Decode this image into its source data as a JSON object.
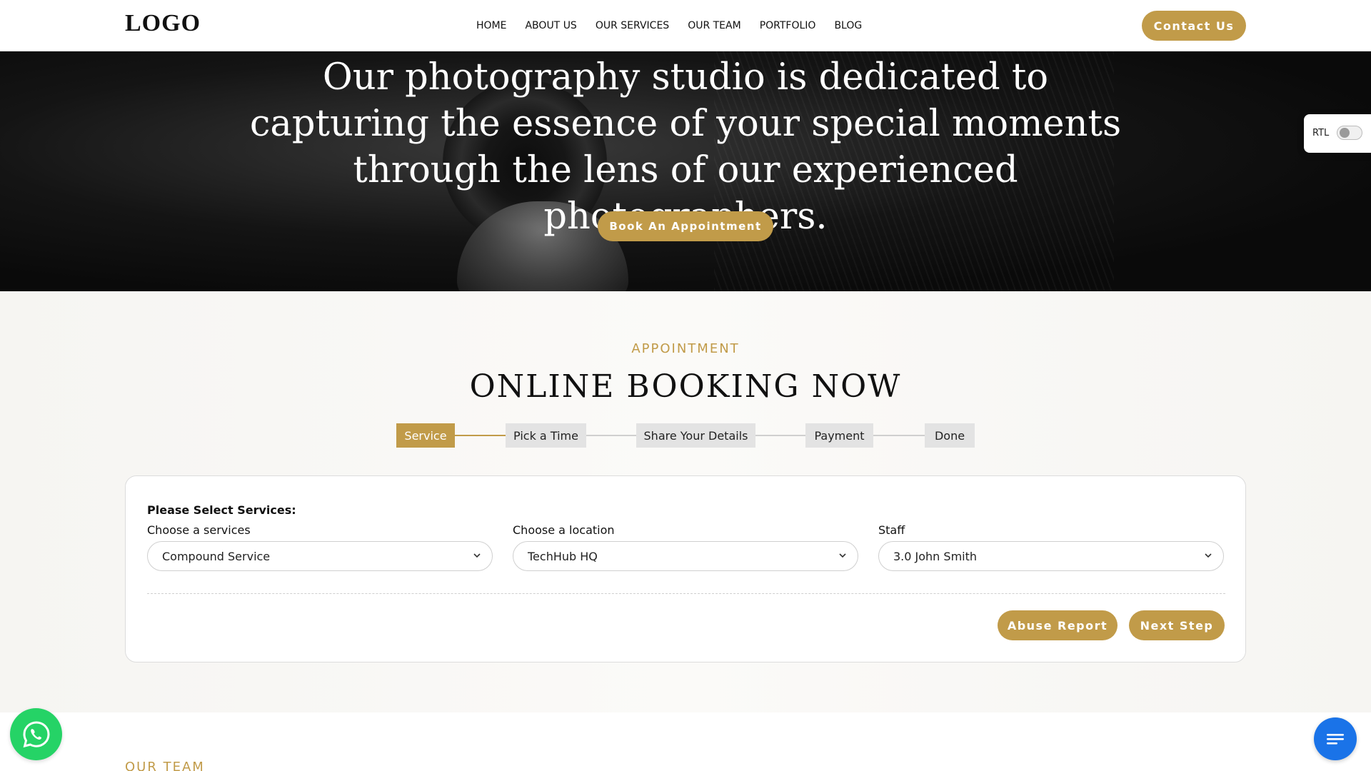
{
  "header": {
    "logo": "LOGO",
    "nav": [
      "HOME",
      "ABOUT US",
      "OUR SERVICES",
      "OUR TEAM",
      "PORTFOLIO",
      "BLOG"
    ],
    "contact_label": "Contact Us"
  },
  "hero": {
    "title": "Our photography studio is dedicated to capturing the essence of your special moments through the lens of our experienced photographers.",
    "cta_label": "Book An Appointment"
  },
  "rtl": {
    "label": "RTL",
    "enabled": false
  },
  "booking": {
    "eyebrow": "APPOINTMENT",
    "title": "ONLINE BOOKING NOW",
    "steps": [
      {
        "label": "Service",
        "active": true
      },
      {
        "label": "Pick a Time",
        "active": false
      },
      {
        "label": "Share Your Details",
        "active": false
      },
      {
        "label": "Payment",
        "active": false
      },
      {
        "label": "Done",
        "active": false
      }
    ],
    "form": {
      "heading": "Please Select Services:",
      "service_label": "Choose a services",
      "service_value": "Compound Service",
      "location_label": "Choose a location",
      "location_value": "TechHub HQ",
      "staff_label": "Staff",
      "staff_value": "3.0 John Smith",
      "abuse_label": "Abuse Report",
      "next_label": "Next Step"
    }
  },
  "team_peek": "OUR TEAM",
  "colors": {
    "accent": "#c19b49",
    "whatsapp": "#25d366",
    "chat": "#1a73e8"
  },
  "icons": {
    "chevron": "chevron-down-icon",
    "whatsapp": "whatsapp-icon",
    "chat": "chat-icon"
  }
}
